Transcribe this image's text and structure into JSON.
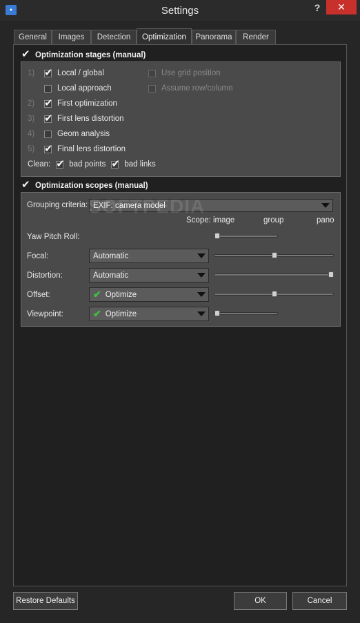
{
  "window": {
    "title": "Settings",
    "app_icon": "app-icon",
    "help_label": "?",
    "close_label": "✕"
  },
  "tabs": [
    "General",
    "Images",
    "Detection",
    "Optimization",
    "Panorama",
    "Render"
  ],
  "active_tab": "Optimization",
  "stages": {
    "header": "Optimization stages (manual)",
    "enabled": true,
    "items": [
      {
        "num": "1)",
        "label": "Local / global",
        "checked": true
      },
      {
        "num": "",
        "label": "Local approach",
        "checked": false
      },
      {
        "num": "2)",
        "label": "First optimization",
        "checked": true
      },
      {
        "num": "3)",
        "label": "First lens distortion",
        "checked": true
      },
      {
        "num": "4)",
        "label": "Geom analysis",
        "checked": false
      },
      {
        "num": "5)",
        "label": "Final lens distortion",
        "checked": true
      }
    ],
    "right_items": [
      {
        "label": "Use grid position",
        "checked": false,
        "disabled": true
      },
      {
        "label": "Assume row/column",
        "checked": false,
        "disabled": true
      }
    ],
    "clean": {
      "label": "Clean:",
      "bad_points": "bad points",
      "bad_links": "bad links",
      "bad_points_checked": true,
      "bad_links_checked": true
    }
  },
  "scopes": {
    "header": "Optimization scopes (manual)",
    "enabled": true,
    "grouping_label": "Grouping criteria:",
    "grouping_value": "EXIF: camera model",
    "scope_label": "Scope:",
    "scope_ticks": [
      "image",
      "group",
      "pano"
    ],
    "rows": [
      {
        "label": "Yaw Pitch Roll:",
        "dropdown": null,
        "slider_level": 0.0
      },
      {
        "label": "Focal:",
        "dropdown": "Automatic",
        "slider_level": 0.5
      },
      {
        "label": "Distortion:",
        "dropdown": "Automatic",
        "slider_level": 1.0
      },
      {
        "label": "Offset:",
        "dropdown": "Optimize",
        "slider_level": 0.5
      },
      {
        "label": "Viewpoint:",
        "dropdown": "Optimize",
        "slider_level": 0.0
      }
    ]
  },
  "buttons": {
    "restore": "Restore Defaults",
    "ok": "OK",
    "cancel": "Cancel"
  },
  "watermark": "SOFTPEDIA",
  "colors": {
    "background": "#262626",
    "group": "#4a4a4a",
    "close": "#c7302b",
    "optimize_check": "#3fc33f"
  }
}
